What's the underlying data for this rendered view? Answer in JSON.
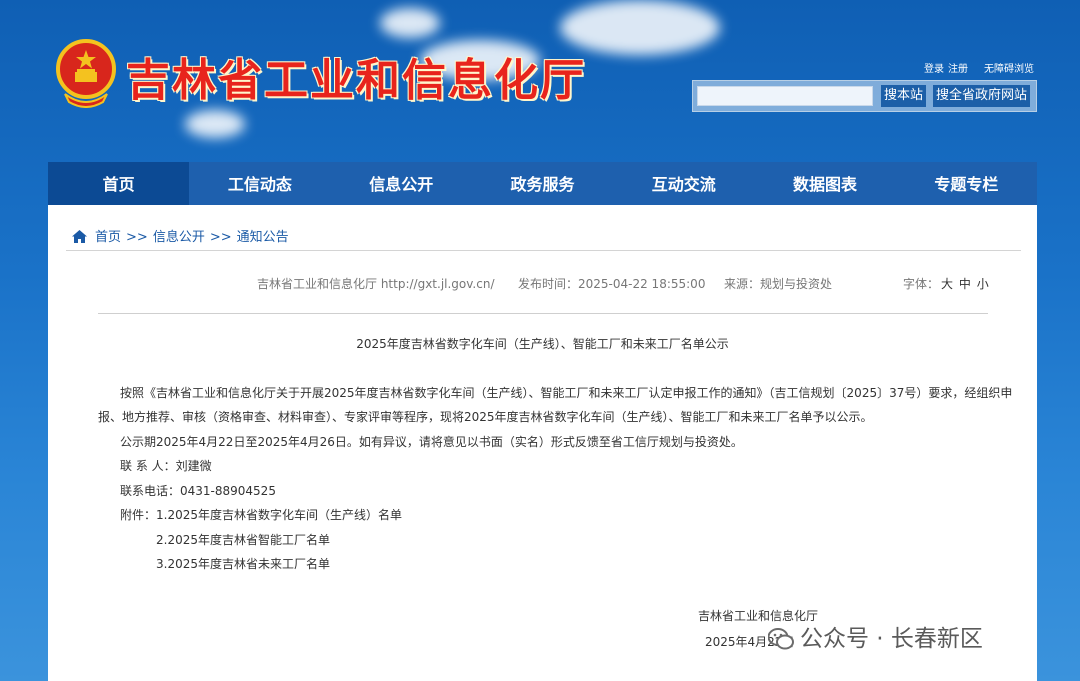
{
  "header": {
    "site_title": "吉林省工业和信息化厅",
    "links": {
      "login": "登录",
      "register": "注册",
      "accessible": "无障碍浏览"
    },
    "search": {
      "placeholder": "",
      "site_button": "搜本站",
      "gov_button": "搜全省政府网站"
    }
  },
  "nav": {
    "items": [
      {
        "label": "首页"
      },
      {
        "label": "工信动态"
      },
      {
        "label": "信息公开"
      },
      {
        "label": "政务服务"
      },
      {
        "label": "互动交流"
      },
      {
        "label": "数据图表"
      },
      {
        "label": "专题专栏"
      }
    ]
  },
  "breadcrumb": {
    "home": "首页",
    "sep": ">>",
    "level2": "信息公开",
    "level3": "通知公告"
  },
  "meta": {
    "source_site": "吉林省工业和信息化厅 http://gxt.jl.gov.cn/",
    "published": "发布时间：2025-04-22 18:55:00",
    "origin": "来源：规划与投资处",
    "font_label": "字体：",
    "font_large": "大",
    "font_medium": "中",
    "font_small": "小"
  },
  "article": {
    "title": "2025年度吉林省数字化车间（生产线）、智能工厂和未来工厂名单公示",
    "p1_line1": "按照《吉林省工业和信息化厅关于开展2025年度吉林省数字化车间（生产线）、智能工厂和未来工厂认定申报工作的通知》（吉工信规划〔2025〕37号）要求，经组织申",
    "p1_line2": "报、地方推荐、审核（资格审查、材料审查）、专家评审等程序，现将2025年度吉林省数字化车间（生产线）、智能工厂和未来工厂名单予以公示。",
    "p2": "公示期2025年4月22日至2025年4月26日。如有异议，请将意见以书面（实名）形式反馈至省工信厅规划与投资处。",
    "contact": "联 系 人：刘建微",
    "phone": "联系电话：0431-88904525",
    "attach1": "附件：1.2025年度吉林省数字化车间（生产线）名单",
    "attach2": "2.2025年度吉林省智能工厂名单",
    "attach3": "3.2025年度吉林省未来工厂名单",
    "sign_org": "吉林省工业和信息化厅",
    "sign_date": "2025年4月22日"
  },
  "watermark": {
    "text": "公众号 · 长春新区"
  },
  "colors": {
    "title_red": "#e8241c",
    "nav_blue": "#1e60ae",
    "nav_active": "#0c4a94",
    "link_blue": "#1b5aa6"
  }
}
